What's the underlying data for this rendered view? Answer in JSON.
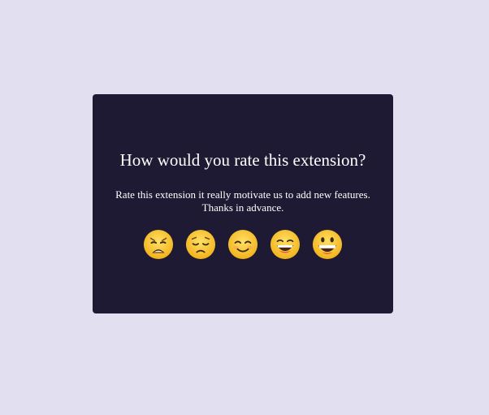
{
  "dialog": {
    "title": "How would you rate this extension?",
    "description_line1": "Rate this extension it really motivate us to add new features.",
    "description_line2": "Thanks in advance."
  },
  "ratings": [
    {
      "icon": "weary-face-icon"
    },
    {
      "icon": "pensive-face-icon"
    },
    {
      "icon": "smiling-face-icon"
    },
    {
      "icon": "grinning-squinting-face-icon"
    },
    {
      "icon": "grinning-face-icon"
    }
  ],
  "colors": {
    "page_background": "#e2e0f0",
    "card_background": "#1e1a33",
    "text": "#ffffff",
    "emoji_face": "#f7c325",
    "emoji_outline": "#e8a91c"
  }
}
